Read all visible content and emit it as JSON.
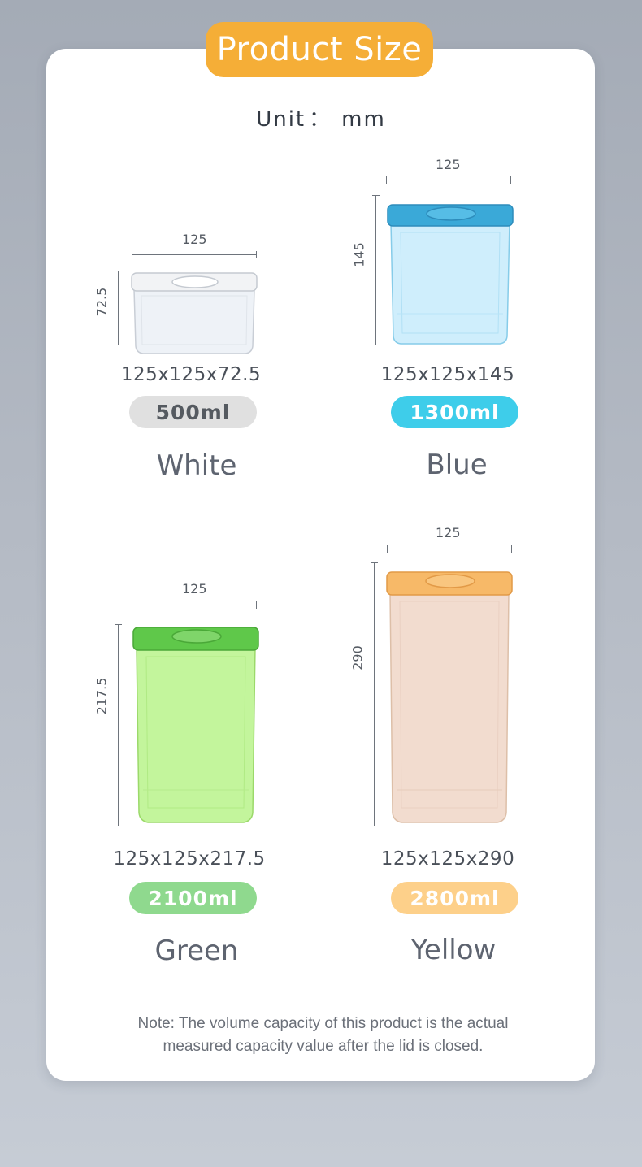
{
  "header": {
    "title": "Product Size"
  },
  "unit": {
    "label": "Unit",
    "colon": "：",
    "value": "mm"
  },
  "products": [
    {
      "width_label": "125",
      "height_label": "72.5",
      "size": "125x125x72.5",
      "volume": "500ml",
      "color_name": "White",
      "pill_color": "#e0e0e0",
      "pill_text_color": "#555a60",
      "lid_color": "#f2f3f5",
      "body_color": "#eef2f7"
    },
    {
      "width_label": "125",
      "height_label": "145",
      "size": "125x125x145",
      "volume": "1300ml",
      "color_name": "Blue",
      "pill_color": "#3ecdea",
      "pill_text_color": "#ffffff",
      "lid_color": "#3aa9d8",
      "body_color": "#cfeefc"
    },
    {
      "width_label": "125",
      "height_label": "217.5",
      "size": "125x125x217.5",
      "volume": "2100ml",
      "color_name": "Green",
      "pill_color": "#8fd98e",
      "pill_text_color": "#ffffff",
      "lid_color": "#5fc84a",
      "body_color": "#c3f59c"
    },
    {
      "width_label": "125",
      "height_label": "290",
      "size": "125x125x290",
      "volume": "2800ml",
      "color_name": "Yellow",
      "pill_color": "#fdd08a",
      "pill_text_color": "#ffffff",
      "lid_color": "#f7b968",
      "body_color": "#f2dccf"
    }
  ],
  "note": "Note: The volume capacity of this product is the actual measured capacity value after the lid is closed."
}
